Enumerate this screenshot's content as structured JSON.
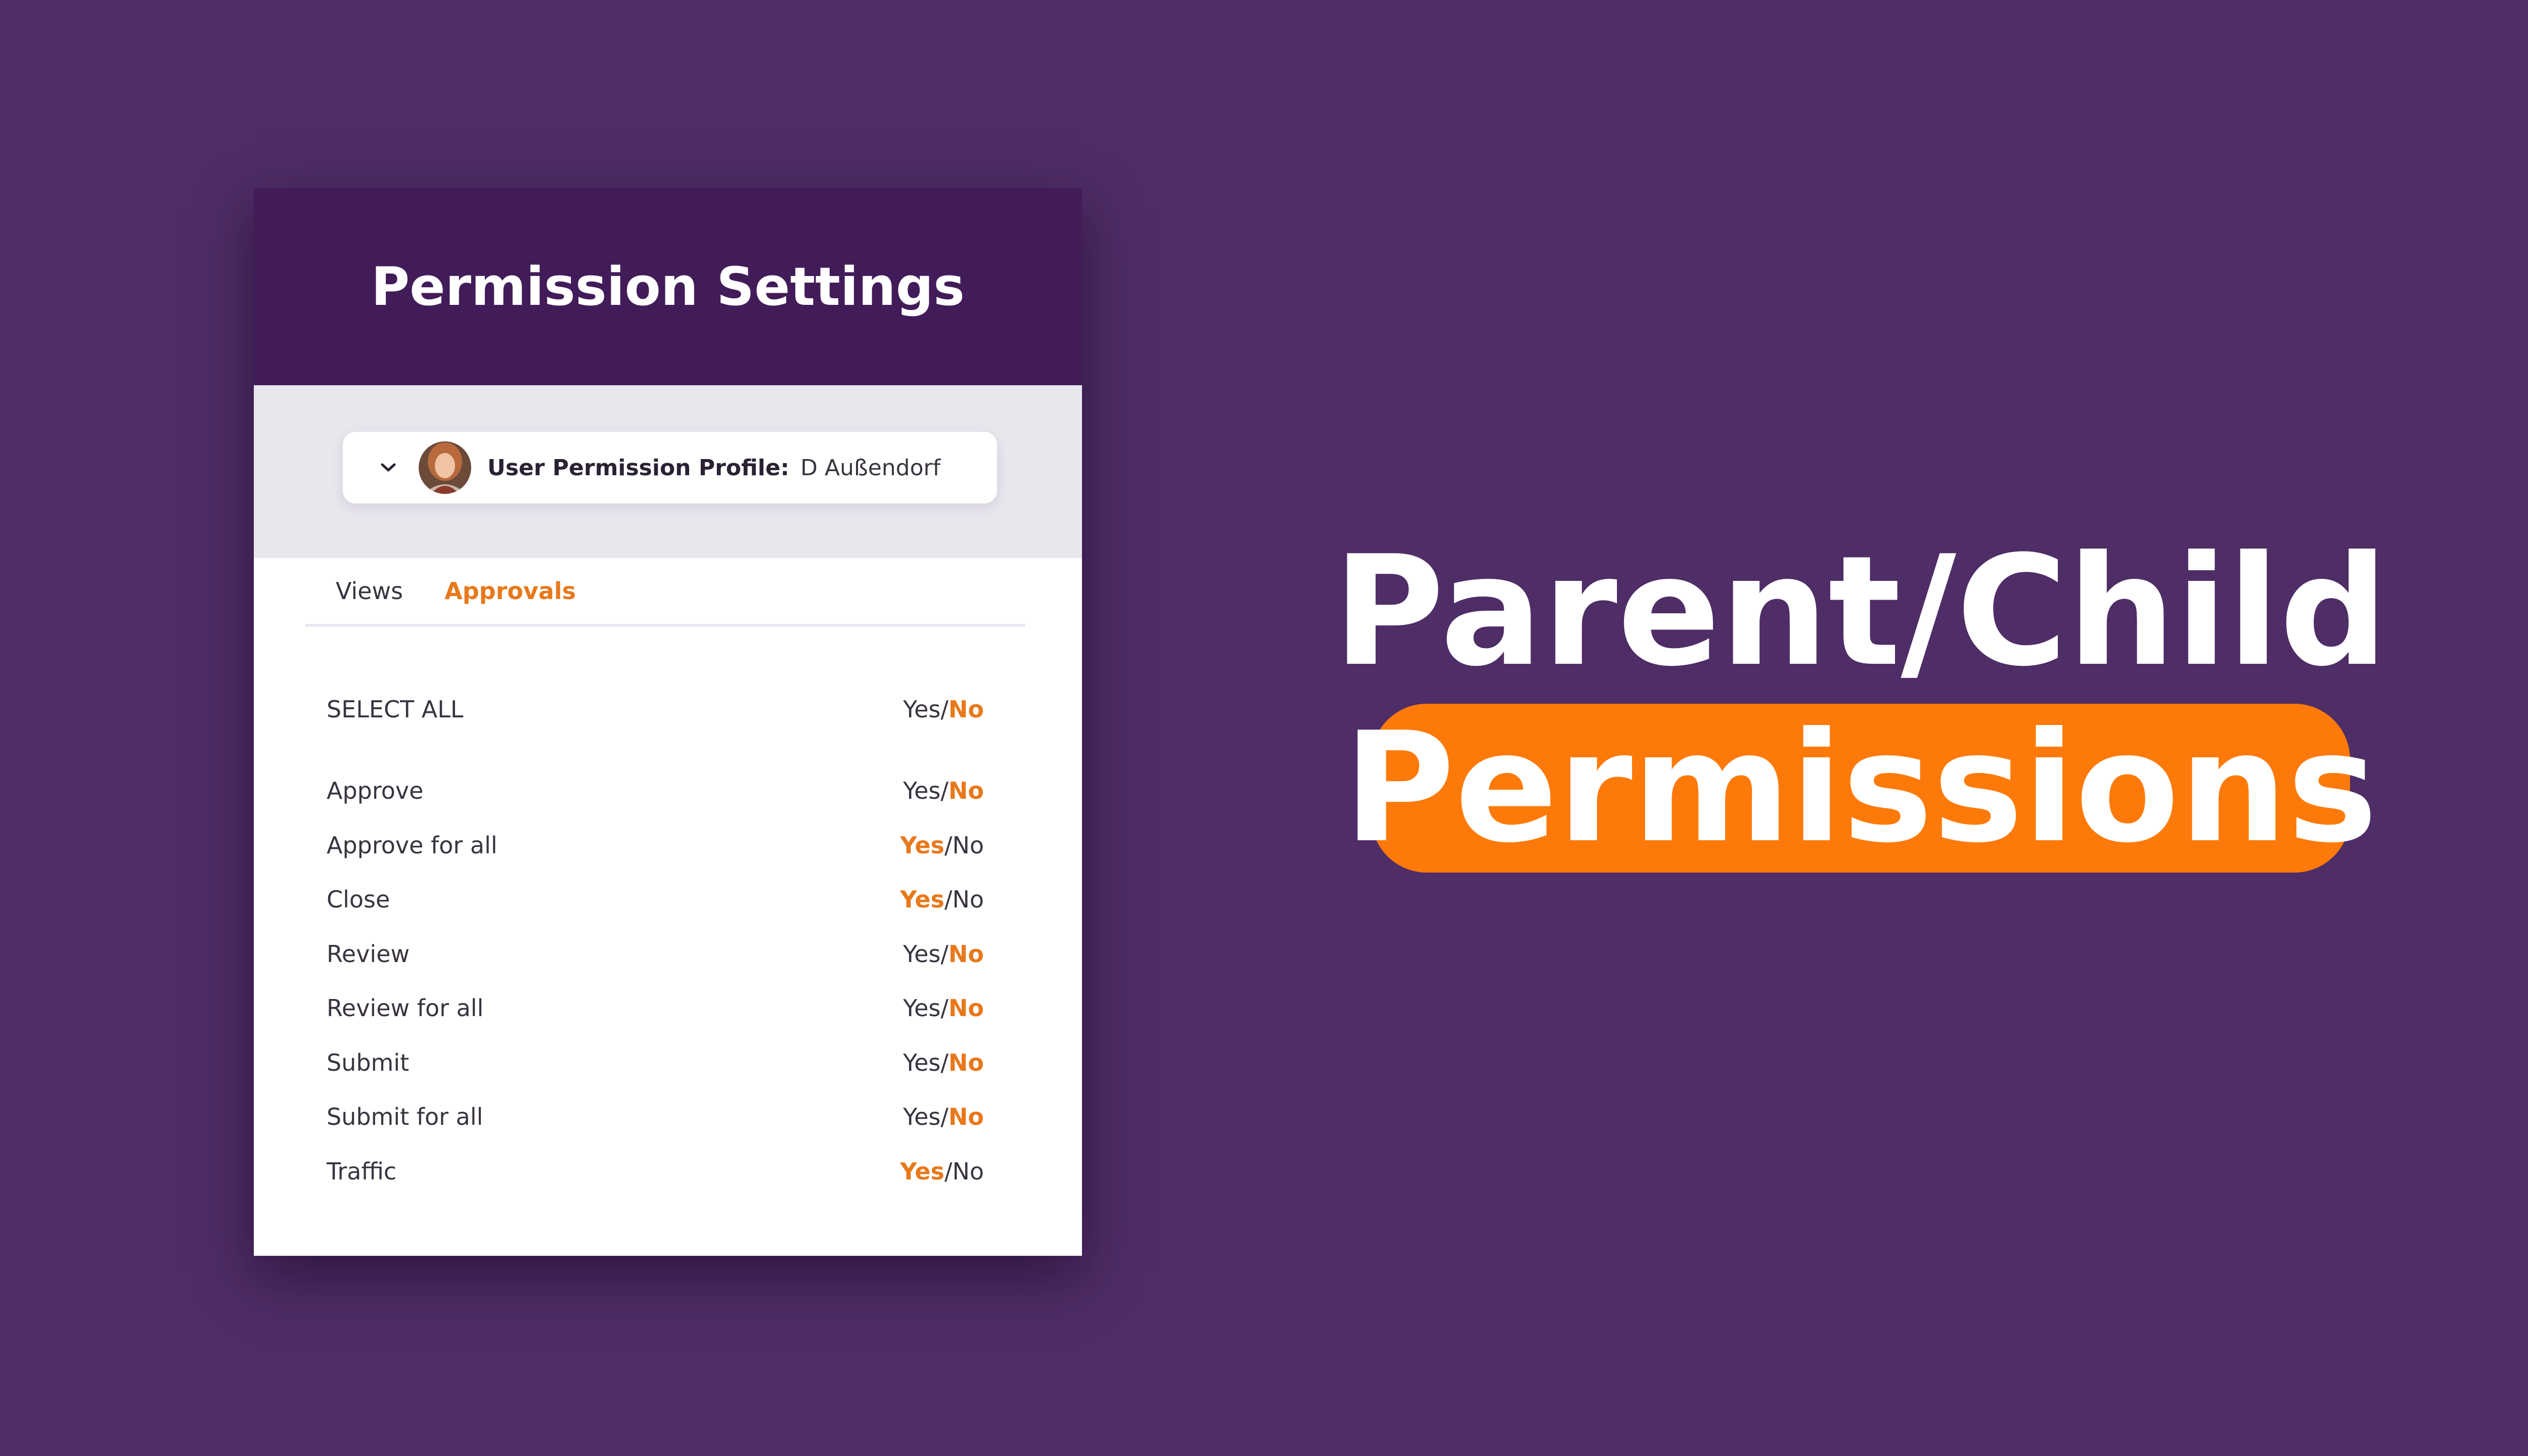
{
  "colors": {
    "background": "#4f2d67",
    "header": "#421c59",
    "accent": "#fd7a0a",
    "active_text": "#e7791c"
  },
  "card": {
    "title": "Permission Settings",
    "profile": {
      "label": "User Permission Profile:",
      "name": "D Außendorf",
      "dropdown_icon": "chevron-down-icon",
      "avatar_icon": "user-avatar"
    },
    "tabs": [
      {
        "label": "Views",
        "active": false
      },
      {
        "label": "Approvals",
        "active": true
      }
    ],
    "select_all": {
      "label": "SELECT ALL",
      "yes": "Yes",
      "sep": "/",
      "no": "No",
      "selected": "No"
    },
    "permissions": [
      {
        "label": "Approve",
        "yes": "Yes",
        "sep": "/",
        "no": "No",
        "selected": "No"
      },
      {
        "label": "Approve for all",
        "yes": "Yes",
        "sep": "/",
        "no": "No",
        "selected": "Yes"
      },
      {
        "label": "Close",
        "yes": "Yes",
        "sep": "/",
        "no": "No",
        "selected": "Yes"
      },
      {
        "label": "Review",
        "yes": "Yes",
        "sep": "/",
        "no": "No",
        "selected": "No"
      },
      {
        "label": "Review for all",
        "yes": "Yes",
        "sep": "/",
        "no": "No",
        "selected": "No"
      },
      {
        "label": "Submit",
        "yes": "Yes",
        "sep": "/",
        "no": "No",
        "selected": "No"
      },
      {
        "label": "Submit for all",
        "yes": "Yes",
        "sep": "/",
        "no": "No",
        "selected": "No"
      },
      {
        "label": "Traffic",
        "yes": "Yes",
        "sep": "/",
        "no": "No",
        "selected": "Yes"
      }
    ]
  },
  "headline": {
    "line1": "Parent/Child",
    "line2": "Permissions"
  }
}
